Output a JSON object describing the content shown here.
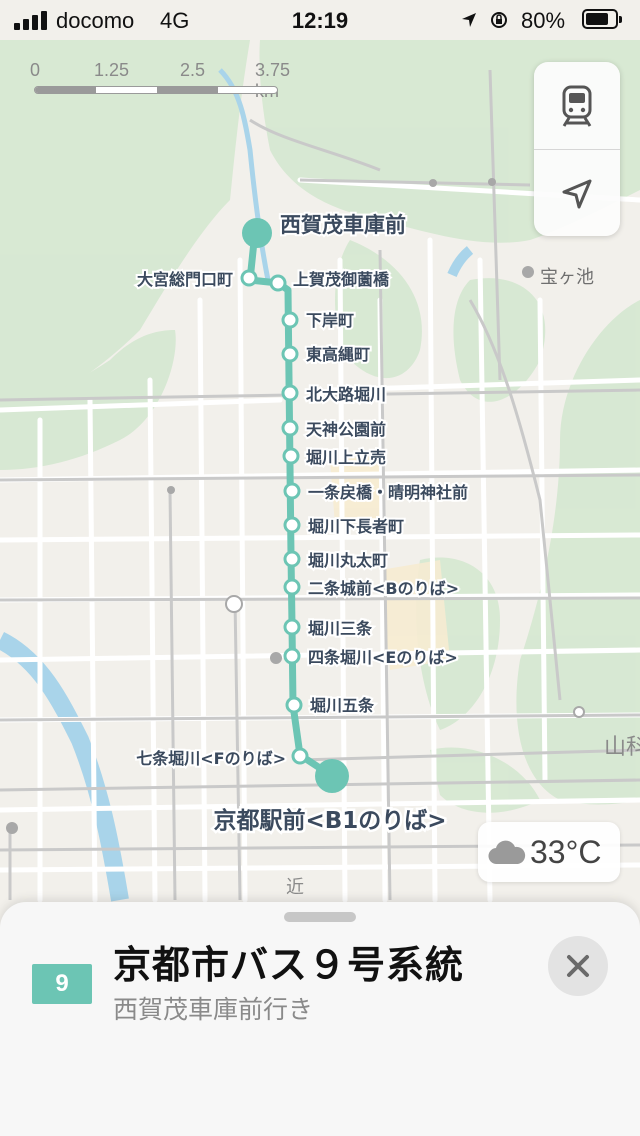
{
  "status_bar": {
    "carrier": "docomo",
    "network": "4G",
    "time": "12:19",
    "battery_text": "80%",
    "battery_level": 0.8,
    "signal_bars": 4,
    "icons": [
      "location-arrow-icon",
      "rotation-lock-icon"
    ]
  },
  "scale_bar": {
    "ticks": [
      "0",
      "1.25",
      "2.5",
      "3.75 km"
    ]
  },
  "map_controls": {
    "transit_icon": "tram-icon",
    "location_icon": "location-arrow-icon"
  },
  "map": {
    "route_color": "#6cc5b4",
    "stops": [
      {
        "id": "nishigamo",
        "label": "西賀茂車庫前",
        "terminal": true
      },
      {
        "id": "omiya",
        "label": "大宮総門口町"
      },
      {
        "id": "kamigamo",
        "label": "上賀茂御薗橋"
      },
      {
        "id": "shimogishi",
        "label": "下岸町"
      },
      {
        "id": "higashitakanawa",
        "label": "東高縄町"
      },
      {
        "id": "kitaoji",
        "label": "北大路堀川"
      },
      {
        "id": "tenjin",
        "label": "天神公園前"
      },
      {
        "id": "kamidachiuri",
        "label": "堀川上立売"
      },
      {
        "id": "ichijo",
        "label": "一条戻橋・晴明神社前"
      },
      {
        "id": "shimochoja",
        "label": "堀川下長者町"
      },
      {
        "id": "marutamachi",
        "label": "堀川丸太町"
      },
      {
        "id": "nijo",
        "label": "二条城前<Bのりば>"
      },
      {
        "id": "sanjo",
        "label": "堀川三条"
      },
      {
        "id": "shijo",
        "label": "四条堀川<Eのりば>"
      },
      {
        "id": "gojo",
        "label": "堀川五条"
      },
      {
        "id": "shichijo",
        "label": "七条堀川<Fのりば>"
      },
      {
        "id": "kyoto",
        "label": "京都駅前<B1のりば>",
        "terminal": true
      }
    ],
    "places": {
      "takaragaike": "宝ヶ池",
      "yamashina": "山科",
      "chikatetsu": "近"
    }
  },
  "weather": {
    "icon": "cloud-icon",
    "temperature": "33°C"
  },
  "sheet": {
    "route_number": "9",
    "title": "京都市バス９号系統",
    "subtitle": "西賀茂車庫前行き",
    "close_icon": "close-icon"
  }
}
